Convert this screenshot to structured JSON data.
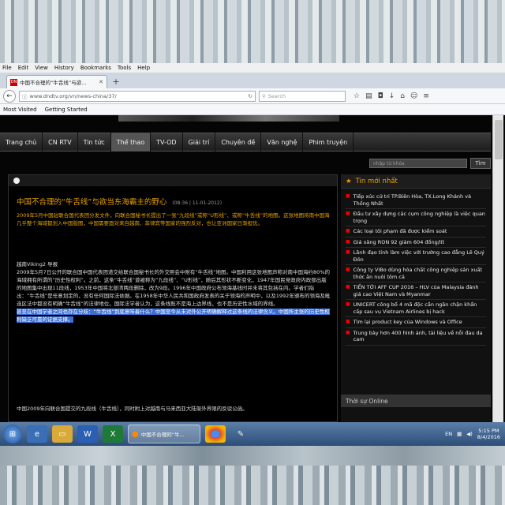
{
  "menu": [
    "File",
    "Edit",
    "View",
    "History",
    "Bookmarks",
    "Tools",
    "Help"
  ],
  "tab": {
    "title": "中国不合理的“牛舌线”与欲...",
    "favicon": "DN"
  },
  "url": "www.dndtv.org/vn/news-china/37/",
  "search_placeholder": "Search",
  "bookmarks": [
    "Most Visited",
    "Getting Started"
  ],
  "site_nav": [
    "Trang chủ",
    "CN RTV",
    "Tin tức",
    "Thể thao",
    "TV-OD",
    "Giải trí",
    "Chuyên đề",
    "Văn nghệ",
    "Phim truyện"
  ],
  "site_nav_active": 3,
  "site_search": {
    "placeholder": "nhập từ khóa",
    "button": "Tìm"
  },
  "article": {
    "title": "中国不合理的“牛舌线”与欲当东海霸主的野心",
    "date": "(08:36 | 11-01-2012)",
    "lead": "2009年5月中国驻联合国代表团分发文件，向联合国秘书长提出了一张“九段线”或称“U形线”、或称“牛舌线”的地图。这张地图将南中国海几乎整个海域都划入中国版图，中国需要面对来自越南、菲律宾等国家的强烈反对，也让亚洲国家日渐担忧。",
    "byline": "越南Viking2 导报",
    "body": "2009年5月7日公开的联合国中国代表团递交给联合国秘书长的外交照会中附有“牛舌线”地图。中国利用这张地图声称对南中国海约80%的海域拥有所谓的“历史性权利”。之前，这条“牛舌线”曾被称为“九段线”、“U形线”，随后其形状不断变化，1947年国民党政府内政部出版的地图集中出现11段线，1953年中国将北部湾两段删除，改为9段。1996年中国政府公布领海基线时并未将其包括在内。学者们指出：“牛舌线”是任意划定的，没有任何国际法依据。在1958年中华人民共和国政府发表的关于领海的声明中，以及1992年颁布的领海及毗连区法中都没有明确“牛舌线”的法律地位。国际法学者认为，这条线既不是海上边界线，也不是历史性水域的界线。",
    "highlight": "甚至在中国学者之间也存在分歧：“牛舌线”到底意味着什么？中国至今从未对外公开明确解释过这条线的法律含义。中国所主张的历史性权利缺乏可靠的证据支撑。",
    "more": "中国2009年向联合国提交的九段线（牛舌线），同时附上对越南与马来西亚大陆架外界限的反驳公函。"
  },
  "sidebar": {
    "title": "Tin mới nhất",
    "items": [
      "Tiếp xúc cử tri TP.Biên Hòa, TX.Long Khánh và Thống Nhất",
      "Đầu tư xây dựng các cụm công nghiệp là việc quan trọng",
      "Các loại tôi phạm đã được kiểm soát",
      "Giá xăng RON 92 giảm 604 đồng/lít",
      "Lãnh đạo tỉnh làm việc với trường cao đẳng Lê Quý Đôn",
      "Công ty VIBo dùng hóa chất công nghiệp sản xuất thức ăn nuôi tôm cá",
      "TIỀN TỚI AFF CUP 2016 – HLV của Malaysia đánh giá cao Việt Nam và Myanmar",
      "UNICERT công bố 4 mã độc cần ngăn chặn khẩn cấp sau vụ Vietnam Airlines bị hack",
      "Tìm lại product key của Windows và Office",
      "Trung bày hơn 400 hình ảnh, tài liệu về nỗi đau da cam"
    ],
    "online_label": "Thời sự Online"
  },
  "taskbar": {
    "active_app": "中国不合理的“牛...",
    "lang": "EN",
    "time": "5:15 PM",
    "date": "8/4/2016"
  },
  "colors": {
    "accent": "#e8a000",
    "highlight": "#3b6fd6",
    "taskbar": "#2c4d78"
  }
}
